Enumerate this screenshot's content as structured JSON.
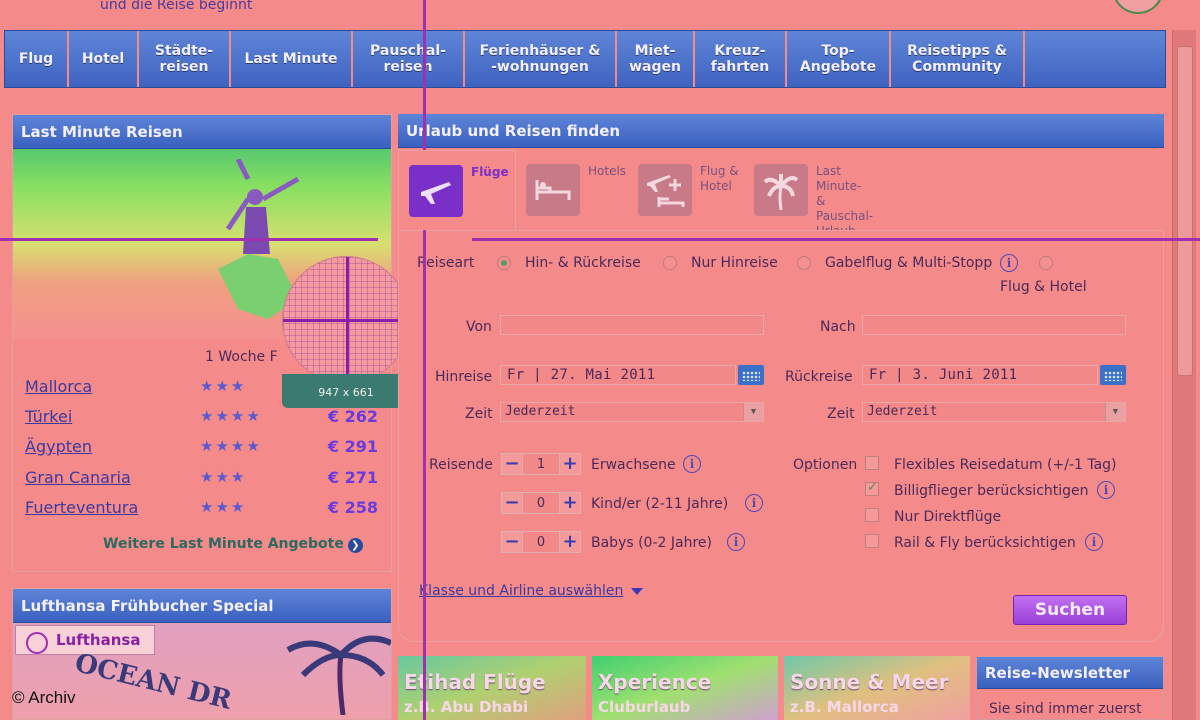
{
  "header": {
    "tagline": "und die Reise beginnt"
  },
  "nav": [
    {
      "label": "Flug"
    },
    {
      "label": "Hotel"
    },
    {
      "label": "Städte-\nreisen"
    },
    {
      "label": "Last Minute"
    },
    {
      "label": "Pauschal-\nreisen"
    },
    {
      "label": "Ferienhäuser &\n-wohnungen"
    },
    {
      "label": "Miet-\nwagen"
    },
    {
      "label": "Kreuz-\nfahrten"
    },
    {
      "label": "Top-\nAngebote"
    },
    {
      "label": "Reisetipps &\nCommunity"
    }
  ],
  "last_minute": {
    "title": "Last Minute Reisen",
    "duration": "1 Woche F",
    "deals": [
      {
        "destination": "Mallorca",
        "stars": "★★★",
        "price": ""
      },
      {
        "destination": "Türkei",
        "stars": "★★★★",
        "price": "€ 262"
      },
      {
        "destination": "Ägypten",
        "stars": "★★★★",
        "price": "€ 291"
      },
      {
        "destination": "Gran Canaria",
        "stars": "★★★",
        "price": "€ 271"
      },
      {
        "destination": "Fuerteventura",
        "stars": "★★★",
        "price": "€ 258"
      }
    ],
    "more_link": "Weitere Last Minute Angebote"
  },
  "magnifier": {
    "label": "947 x 661"
  },
  "lufthansa": {
    "title": "Lufthansa Frühbucher Special",
    "logo_text": "Lufthansa",
    "sign_text": "OCEAN DR"
  },
  "search": {
    "title": "Urlaub und Reisen finden",
    "tabs": [
      {
        "label": "Flüge",
        "icon": "plane-icon"
      },
      {
        "label": "Hotels",
        "icon": "bed-icon"
      },
      {
        "label": "Flug &\nHotel",
        "icon": "plane-bed-icon"
      },
      {
        "label": "Last Minute-\n& Pauschal-\nUrlaub",
        "icon": "palm-icon"
      }
    ],
    "reiseart_label": "Reiseart",
    "reiseart_options": [
      "Hin- & Rückreise",
      "Nur Hinreise",
      "Gabelflug & Multi-Stopp",
      "Flug & Hotel"
    ],
    "von_label": "Von",
    "nach_label": "Nach",
    "von_value": "",
    "nach_value": "",
    "hinreise_label": "Hinreise",
    "hinreise_value": "Fr | 27. Mai 2011",
    "rueckreise_label": "Rückreise",
    "rueckreise_value": "Fr | 3. Juni 2011",
    "zeit_label": "Zeit",
    "zeit_hin_value": "Jederzeit",
    "zeit_rueck_value": "Jederzeit",
    "reisende_label": "Reisende",
    "travellers": [
      {
        "count": "1",
        "label": "Erwachsene"
      },
      {
        "count": "0",
        "label": "Kind/er (2-11 Jahre)"
      },
      {
        "count": "0",
        "label": "Babys (0-2 Jahre)"
      }
    ],
    "optionen_label": "Optionen",
    "options": [
      {
        "label": "Flexibles Reisedatum (+/-1 Tag)",
        "checked": false
      },
      {
        "label": "Billigflieger berücksichtigen",
        "checked": true
      },
      {
        "label": "Nur Direktflüge",
        "checked": false
      },
      {
        "label": "Rail & Fly berücksichtigen",
        "checked": false
      }
    ],
    "klasse_link": "Klasse und Airline auswählen",
    "submit": "Suchen"
  },
  "promos": [
    {
      "title": "Etihad Flüge",
      "sub": "z.B. Abu Dhabi"
    },
    {
      "title": "Xperience",
      "sub": "Cluburlaub"
    },
    {
      "title": "Sonne & Meer",
      "sub": "z.B. Mallorca"
    }
  ],
  "newsletter": {
    "title": "Reise-Newsletter",
    "text": "Sie sind immer zuerst"
  },
  "watermark": "© Archiv"
}
